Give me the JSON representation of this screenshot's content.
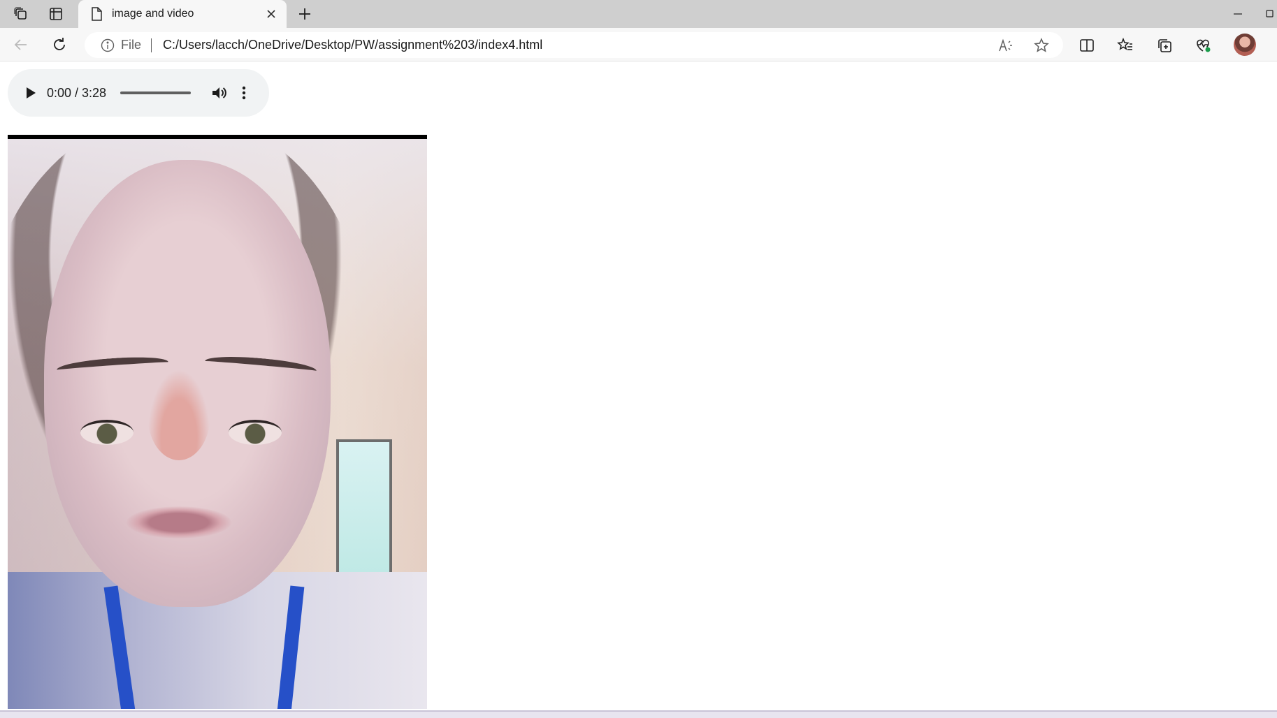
{
  "browser": {
    "tab": {
      "title": "image and video"
    },
    "address": {
      "scheme_label": "File",
      "url": "C:/Users/lacch/OneDrive/Desktop/PW/assignment%203/index4.html"
    }
  },
  "audio_player": {
    "time": "0:00 / 3:28",
    "progress": 0
  },
  "colors": {
    "titlebar_bg": "#cfcfcf",
    "toolbar_bg": "#f7f7f7",
    "audio_control_bg": "#f1f3f4"
  }
}
